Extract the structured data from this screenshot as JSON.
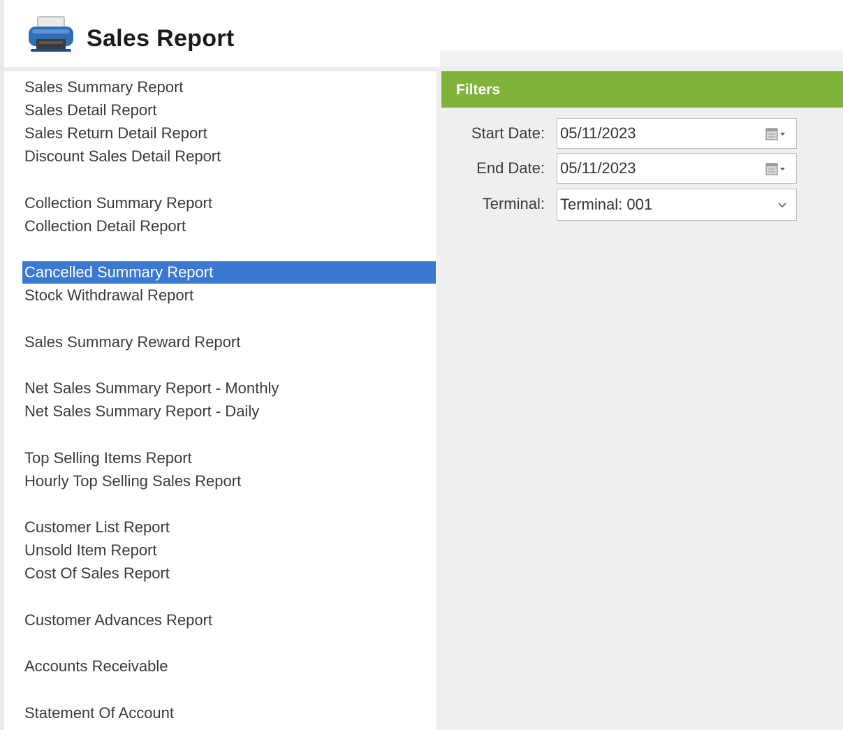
{
  "header": {
    "title": "Sales Report",
    "icon": "printer-icon"
  },
  "reports": [
    {
      "label": "Sales Summary Report",
      "selected": false
    },
    {
      "label": "Sales Detail Report",
      "selected": false
    },
    {
      "label": "Sales Return Detail Report",
      "selected": false
    },
    {
      "label": "Discount Sales Detail Report",
      "selected": false
    },
    {
      "label": "Collection Summary Report",
      "selected": false
    },
    {
      "label": "Collection Detail Report",
      "selected": false
    },
    {
      "label": "Cancelled Summary Report",
      "selected": true
    },
    {
      "label": "Stock Withdrawal Report",
      "selected": false
    },
    {
      "label": "Sales Summary Reward Report",
      "selected": false
    },
    {
      "label": "Net Sales Summary Report - Monthly",
      "selected": false
    },
    {
      "label": "Net Sales Summary Report - Daily",
      "selected": false
    },
    {
      "label": "Top Selling Items Report",
      "selected": false
    },
    {
      "label": "Hourly Top Selling Sales Report",
      "selected": false
    },
    {
      "label": "Customer List Report",
      "selected": false
    },
    {
      "label": "Unsold Item Report",
      "selected": false
    },
    {
      "label": "Cost Of Sales Report",
      "selected": false
    },
    {
      "label": "Customer Advances Report",
      "selected": false
    },
    {
      "label": "Accounts Receivable",
      "selected": false
    },
    {
      "label": "Statement Of Account",
      "selected": false
    }
  ],
  "filters": {
    "title": "Filters",
    "start_date": {
      "label": "Start Date:",
      "value": "05/11/2023",
      "icon": "calendar-dropdown-icon"
    },
    "end_date": {
      "label": "End Date:",
      "value": "05/11/2023",
      "icon": "calendar-dropdown-icon"
    },
    "terminal": {
      "label": "Terminal:",
      "value": "Terminal: 001",
      "icon": "chevron-down-icon"
    }
  },
  "colors": {
    "filters_header": "#7fb33a",
    "selection": "#3a78d2",
    "printer_body": "#2f6db5"
  }
}
